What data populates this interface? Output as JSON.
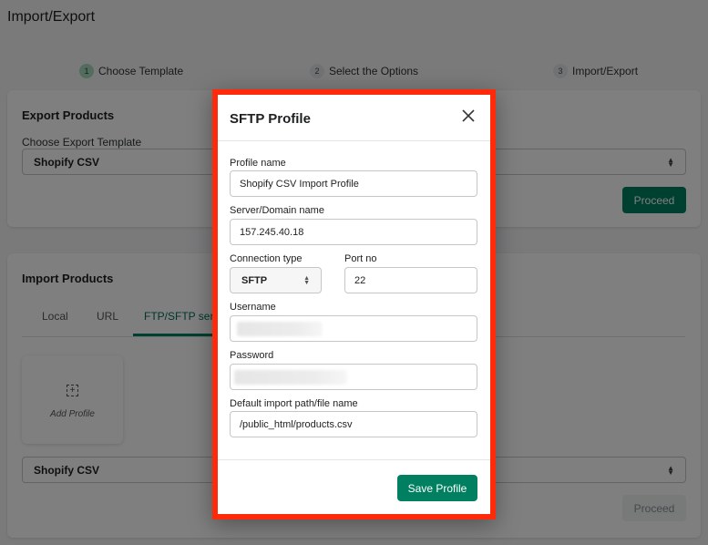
{
  "page": {
    "title": "Import/Export"
  },
  "stepper": {
    "steps": [
      {
        "number": "1",
        "label": "Choose Template",
        "active": true
      },
      {
        "number": "2",
        "label": "Select the Options",
        "active": false
      },
      {
        "number": "3",
        "label": "Import/Export",
        "active": false
      }
    ]
  },
  "export_card": {
    "title": "Export Products",
    "template_label": "Choose Export Template",
    "template_value": "Shopify CSV",
    "proceed_label": "Proceed"
  },
  "import_card": {
    "title": "Import Products",
    "tabs": [
      {
        "label": "Local",
        "active": false
      },
      {
        "label": "URL",
        "active": false
      },
      {
        "label": "FTP/SFTP server",
        "active": true
      }
    ],
    "add_profile_label": "Add Profile",
    "template_value": "Shopify CSV",
    "proceed_label": "Proceed"
  },
  "modal": {
    "title": "SFTP Profile",
    "fields": {
      "profile_name": {
        "label": "Profile name",
        "value": "Shopify CSV Import Profile"
      },
      "server": {
        "label": "Server/Domain name",
        "value": "157.245.40.18"
      },
      "connection_type": {
        "label": "Connection type",
        "value": "SFTP"
      },
      "port": {
        "label": "Port no",
        "value": "22"
      },
      "username": {
        "label": "Username",
        "value": ""
      },
      "password": {
        "label": "Password",
        "value": ""
      },
      "import_path": {
        "label": "Default import path/file name",
        "value": "/public_html/products.csv"
      }
    },
    "save_label": "Save Profile"
  },
  "colors": {
    "primary": "#008060",
    "highlight_border": "#ff2a0a"
  }
}
